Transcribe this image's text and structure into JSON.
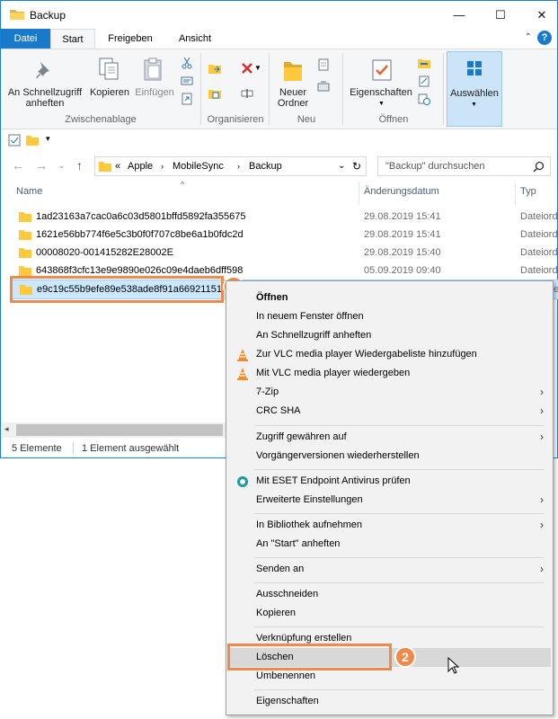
{
  "window": {
    "title": "Backup",
    "minimize_glyph": "—",
    "maximize_glyph": "☐",
    "close_glyph": "✕"
  },
  "ribbon_tabs": [
    "Datei",
    "Start",
    "Freigeben",
    "Ansicht"
  ],
  "ribbon": {
    "pin_label_1": "An Schnellzugriff",
    "pin_label_2": "anheften",
    "copy_label": "Kopieren",
    "paste_label": "Einfügen",
    "group_clipboard": "Zwischenablage",
    "group_organize": "Organisieren",
    "new_folder_1": "Neuer",
    "new_folder_2": "Ordner",
    "group_new": "Neu",
    "properties_label": "Eigenschaften",
    "group_open": "Öffnen",
    "select_label": "Auswählen"
  },
  "address": {
    "path": [
      "Apple",
      "MobileSync",
      "Backup"
    ],
    "prefix": "«",
    "search_placeholder": "\"Backup\" durchsuchen"
  },
  "columns": {
    "name": "Name",
    "date": "Änderungsdatum",
    "type": "Typ"
  },
  "files": [
    {
      "name": "1ad23163a7cac0a6c03d5801bffd5892fa355675",
      "date": "29.08.2019 15:41",
      "type": "Dateiord"
    },
    {
      "name": "1621e56bb774f6e5c3b0f0f707c8be6a1b0fdc2d",
      "date": "29.08.2019 15:41",
      "type": "Dateiord"
    },
    {
      "name": "00008020-001415282E28002E",
      "date": "29.08.2019 15:40",
      "type": "Dateiord"
    },
    {
      "name": "643868f3cfc13e9e9890e026c09e4daeb6dff598",
      "date": "05.09.2019 09:40",
      "type": "Dateiord"
    },
    {
      "name": "e9c19c55b9efe89e538ade8f91a669211511",
      "date": "",
      "type": "de"
    }
  ],
  "status": {
    "count": "5 Elemente",
    "selected": "1 Element ausgewählt"
  },
  "badges": [
    "1",
    "2"
  ],
  "context_menu": [
    {
      "label": "Öffnen",
      "bold": true,
      "icon": "",
      "arrow": false
    },
    {
      "label": "In neuem Fenster öffnen",
      "icon": "",
      "arrow": false
    },
    {
      "label": "An Schnellzugriff anheften",
      "icon": "",
      "arrow": false
    },
    {
      "label": "Zur VLC media player Wiedergabeliste hinzufügen",
      "icon": "vlc-icon",
      "arrow": false
    },
    {
      "label": "Mit VLC media player wiedergeben",
      "icon": "vlc-icon",
      "arrow": false
    },
    {
      "label": "7-Zip",
      "icon": "",
      "arrow": true
    },
    {
      "label": "CRC SHA",
      "icon": "",
      "arrow": true
    },
    {
      "label": "Zugriff gewähren auf",
      "icon": "",
      "arrow": true
    },
    {
      "label": "Vorgängerversionen wiederherstellen",
      "icon": "",
      "arrow": false
    },
    {
      "label": "Mit ESET Endpoint Antivirus prüfen",
      "icon": "eset-icon",
      "arrow": false
    },
    {
      "label": "Erweiterte Einstellungen",
      "icon": "",
      "arrow": true
    },
    {
      "label": "In Bibliothek aufnehmen",
      "icon": "",
      "arrow": true
    },
    {
      "label": "An \"Start\" anheften",
      "icon": "",
      "arrow": false
    },
    {
      "label": "Senden an",
      "icon": "",
      "arrow": true
    },
    {
      "label": "Ausschneiden",
      "icon": "",
      "arrow": false
    },
    {
      "label": "Kopieren",
      "icon": "",
      "arrow": false
    },
    {
      "label": "Verknüpfung erstellen",
      "icon": "",
      "arrow": false
    },
    {
      "label": "Löschen",
      "icon": "",
      "arrow": false,
      "hover": true
    },
    {
      "label": "Umbenennen",
      "icon": "",
      "arrow": false
    },
    {
      "label": "Eigenschaften",
      "icon": "",
      "arrow": false
    }
  ],
  "colors": {
    "accent": "#1979ca",
    "highlight": "#f08a4b",
    "selection": "#cce8ff",
    "folder": "#ffc83d"
  }
}
